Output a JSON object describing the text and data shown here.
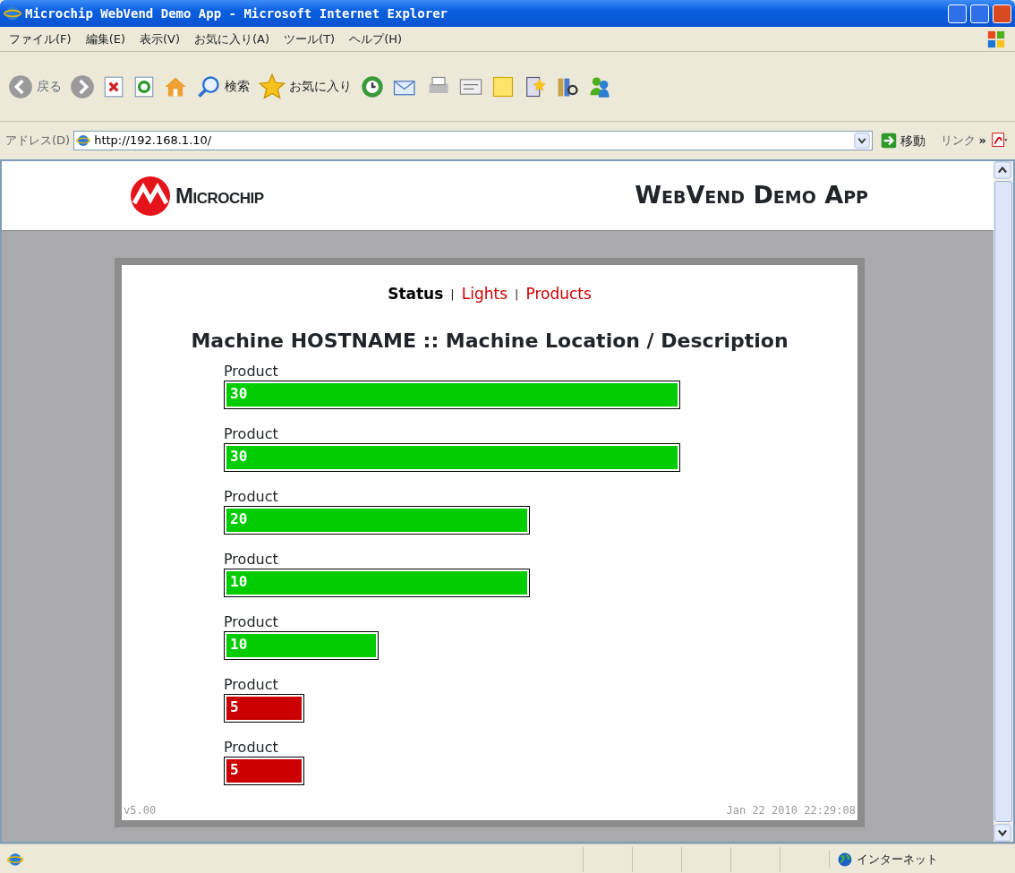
{
  "window": {
    "title": "Microchip WebVend Demo App - Microsoft Internet Explorer"
  },
  "menu": [
    "ファイル(F)",
    "編集(E)",
    "表示(V)",
    "お気に入り(A)",
    "ツール(T)",
    "ヘルプ(H)"
  ],
  "toolbar": {
    "back": "戻る",
    "search": "検索",
    "favorites": "お気に入り"
  },
  "address": {
    "label": "アドレス(D)",
    "url": "http://192.168.1.10/",
    "go": "移動",
    "links": "リンク",
    "more": "»"
  },
  "header": {
    "logo": "Microchip",
    "title": "WebVend Demo App"
  },
  "nav": [
    {
      "label": "Status",
      "selected": true
    },
    {
      "label": "Lights",
      "selected": false
    },
    {
      "label": "Products",
      "selected": false
    }
  ],
  "nav_separator": "|",
  "heading": "Machine HOSTNAME :: Machine Location / Description",
  "products": [
    {
      "name": "Product",
      "value": "30",
      "kind": "full",
      "color": "#00cc00"
    },
    {
      "name": "Product",
      "value": "30",
      "kind": "full",
      "color": "#00cc00"
    },
    {
      "name": "Product",
      "value": "20",
      "kind": "large",
      "color": "#00cc00"
    },
    {
      "name": "Product",
      "value": "10",
      "kind": "large",
      "color": "#00cc00"
    },
    {
      "name": "Product",
      "value": "10",
      "kind": "medium",
      "color": "#00cc00"
    },
    {
      "name": "Product",
      "value": "5",
      "kind": "small",
      "color": "#cc0000"
    },
    {
      "name": "Product",
      "value": "5",
      "kind": "small",
      "color": "#cc0000"
    }
  ],
  "footer": {
    "version": "v5.00",
    "timestamp": "Jan 22 2010 22:29:08"
  },
  "status_bar": {
    "zone": "インターネット"
  }
}
